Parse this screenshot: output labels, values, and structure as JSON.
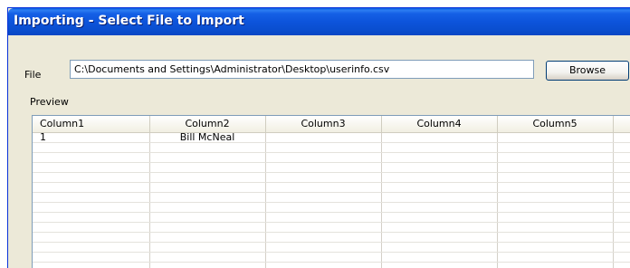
{
  "window": {
    "title": "Importing - Select File to Import"
  },
  "file": {
    "label": "File",
    "value": "C:\\Documents and Settings\\Administrator\\Desktop\\userinfo.csv",
    "browse_label": "Browse"
  },
  "preview": {
    "label": "Preview",
    "columns": [
      "Column1",
      "Column2",
      "Column3",
      "Column4",
      "Column5"
    ],
    "rows": [
      [
        "1",
        "Bill McNeal",
        "",
        "",
        ""
      ]
    ]
  },
  "colors": {
    "titlebar": "#0a54d9",
    "window_background": "#ece9d8",
    "input_border": "#7f9db9"
  }
}
